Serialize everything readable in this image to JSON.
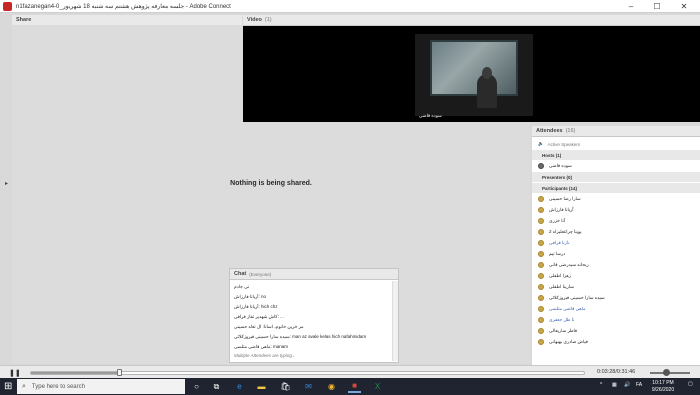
{
  "window": {
    "title": "n1fazanegan4-0_جلسه معارفه پژوهش هشتم سه شنبه 18 شهریور - Adobe Connect",
    "controls": {
      "minimize": "–",
      "maximize": "☐",
      "close": "✕"
    }
  },
  "share_pod": {
    "title": "Share",
    "message": "Nothing is being shared."
  },
  "video_pod": {
    "title": "Video",
    "count": "(1)",
    "camera_name": "سوده قاضی"
  },
  "attendees_pod": {
    "title": "Attendees",
    "count": "(16)",
    "active_speakers": "Active Speakers",
    "hosts": {
      "label": "Hosts (1)",
      "members": [
        "سوده قاضی"
      ]
    },
    "presenters": {
      "label": "Presenters (0)"
    },
    "participants": {
      "label": "Participants (14)",
      "members": [
        {
          "name": "سارا رضا حسینی",
          "blue": false
        },
        {
          "name": "آریانا فارزاش",
          "blue": false
        },
        {
          "name": "آنا خزری",
          "blue": false
        },
        {
          "name": "2 پوپنا چراغعلیزاه",
          "blue": false
        },
        {
          "name": "نازنا فرافی",
          "blue": true
        },
        {
          "name": "درسا تیم",
          "blue": false
        },
        {
          "name": "ریحانه سیدرضی قانی",
          "blue": false
        },
        {
          "name": "زهرا اطفلی",
          "blue": false
        },
        {
          "name": "سارینا اطفلی",
          "blue": false
        },
        {
          "name": "سیده سارا حسینی فیروزکلائی",
          "blue": false
        },
        {
          "name": "ماهی قاضی متلسی",
          "blue": true
        },
        {
          "name": "نا طل جعفری",
          "blue": true
        },
        {
          "name": "فاطر ساریعالی",
          "blue": false
        },
        {
          "name": "فیاض صادری بهبهانی",
          "blue": false
        }
      ]
    }
  },
  "chat_pod": {
    "title": "Chat",
    "scope": "(Everyone)",
    "messages": [
      "نی جادم",
      "آریانا فارزاش: no",
      "آریانا فارزاش: hich chz",
      "کاش شهدیر تفاز فرافی: ...",
      "مر خرین خانوم، اسانا: ال تعاه حسینی",
      "سیده سارا حسینی فیروزکلائی: man az avale kelas hich nafahmidam",
      "ماهی قاضی متلسی: manam"
    ],
    "typing": "Multiple Attendees are typing..."
  },
  "playback": {
    "play_icon": "pause-icon",
    "time": "0:03:28/0:31:46",
    "progress_fraction": 0.16
  },
  "taskbar": {
    "search_placeholder": "Type here to search",
    "clock_time": "10:17 PM",
    "clock_date": "9/26/2020",
    "lang": "FA",
    "tray_up": "^"
  }
}
